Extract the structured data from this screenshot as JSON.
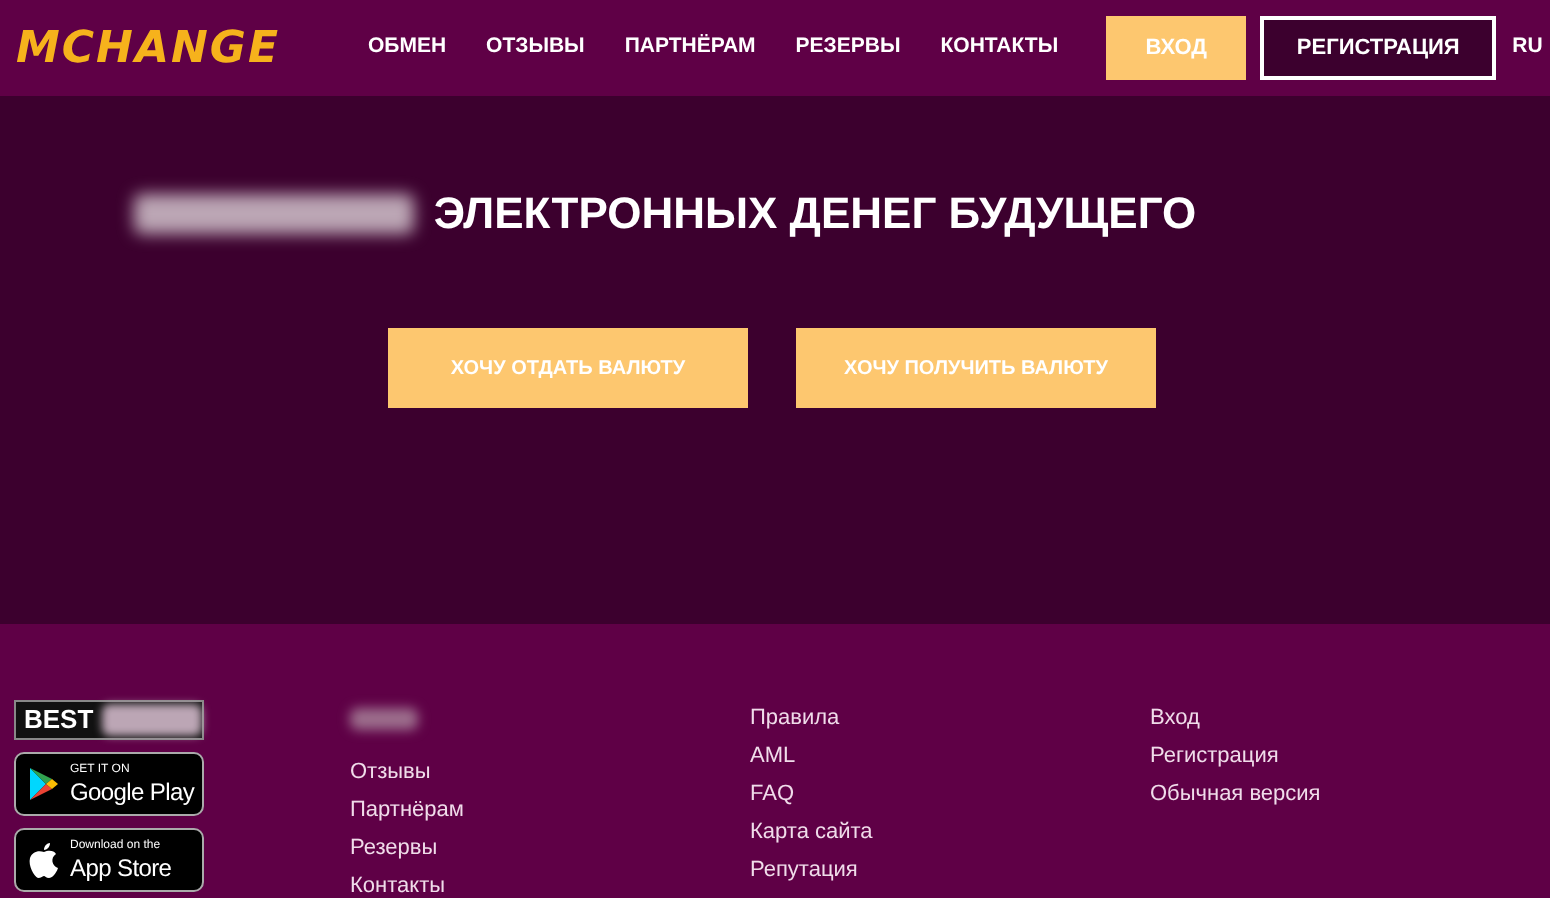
{
  "logo": "MCHANGE",
  "nav": [
    "ОБМЕН",
    "ОТЗЫВЫ",
    "ПАРТНЁРАМ",
    "РЕЗЕРВЫ",
    "КОНТАКТЫ"
  ],
  "auth_buttons": [
    {
      "label": "ВХОД",
      "kind": "filled"
    },
    {
      "label": "РЕГИСТРАЦИЯ",
      "kind": "outline"
    }
  ],
  "language": "RU",
  "hero": {
    "title": "ЭЛЕКТРОННЫХ ДЕНЕГ БУДУЩЕГО",
    "buttons": [
      "ХОЧУ ОТДАТЬ ВАЛЮТУ",
      "ХОЧУ ПОЛУЧИТЬ ВАЛЮТУ"
    ]
  },
  "footer": {
    "badge": "BEST",
    "stores": [
      {
        "kind": "google",
        "small": "GET IT ON",
        "big": "Google Play"
      },
      {
        "kind": "apple",
        "small": "Download on the",
        "big": "App Store"
      }
    ],
    "columns": [
      [
        "Отзывы",
        "Партнёрам",
        "Резервы",
        "Контакты"
      ],
      [
        "Правила",
        "AML",
        "FAQ",
        "Карта сайта",
        "Репутация"
      ],
      [
        "Вход",
        "Регистрация",
        "Обычная версия"
      ]
    ]
  }
}
